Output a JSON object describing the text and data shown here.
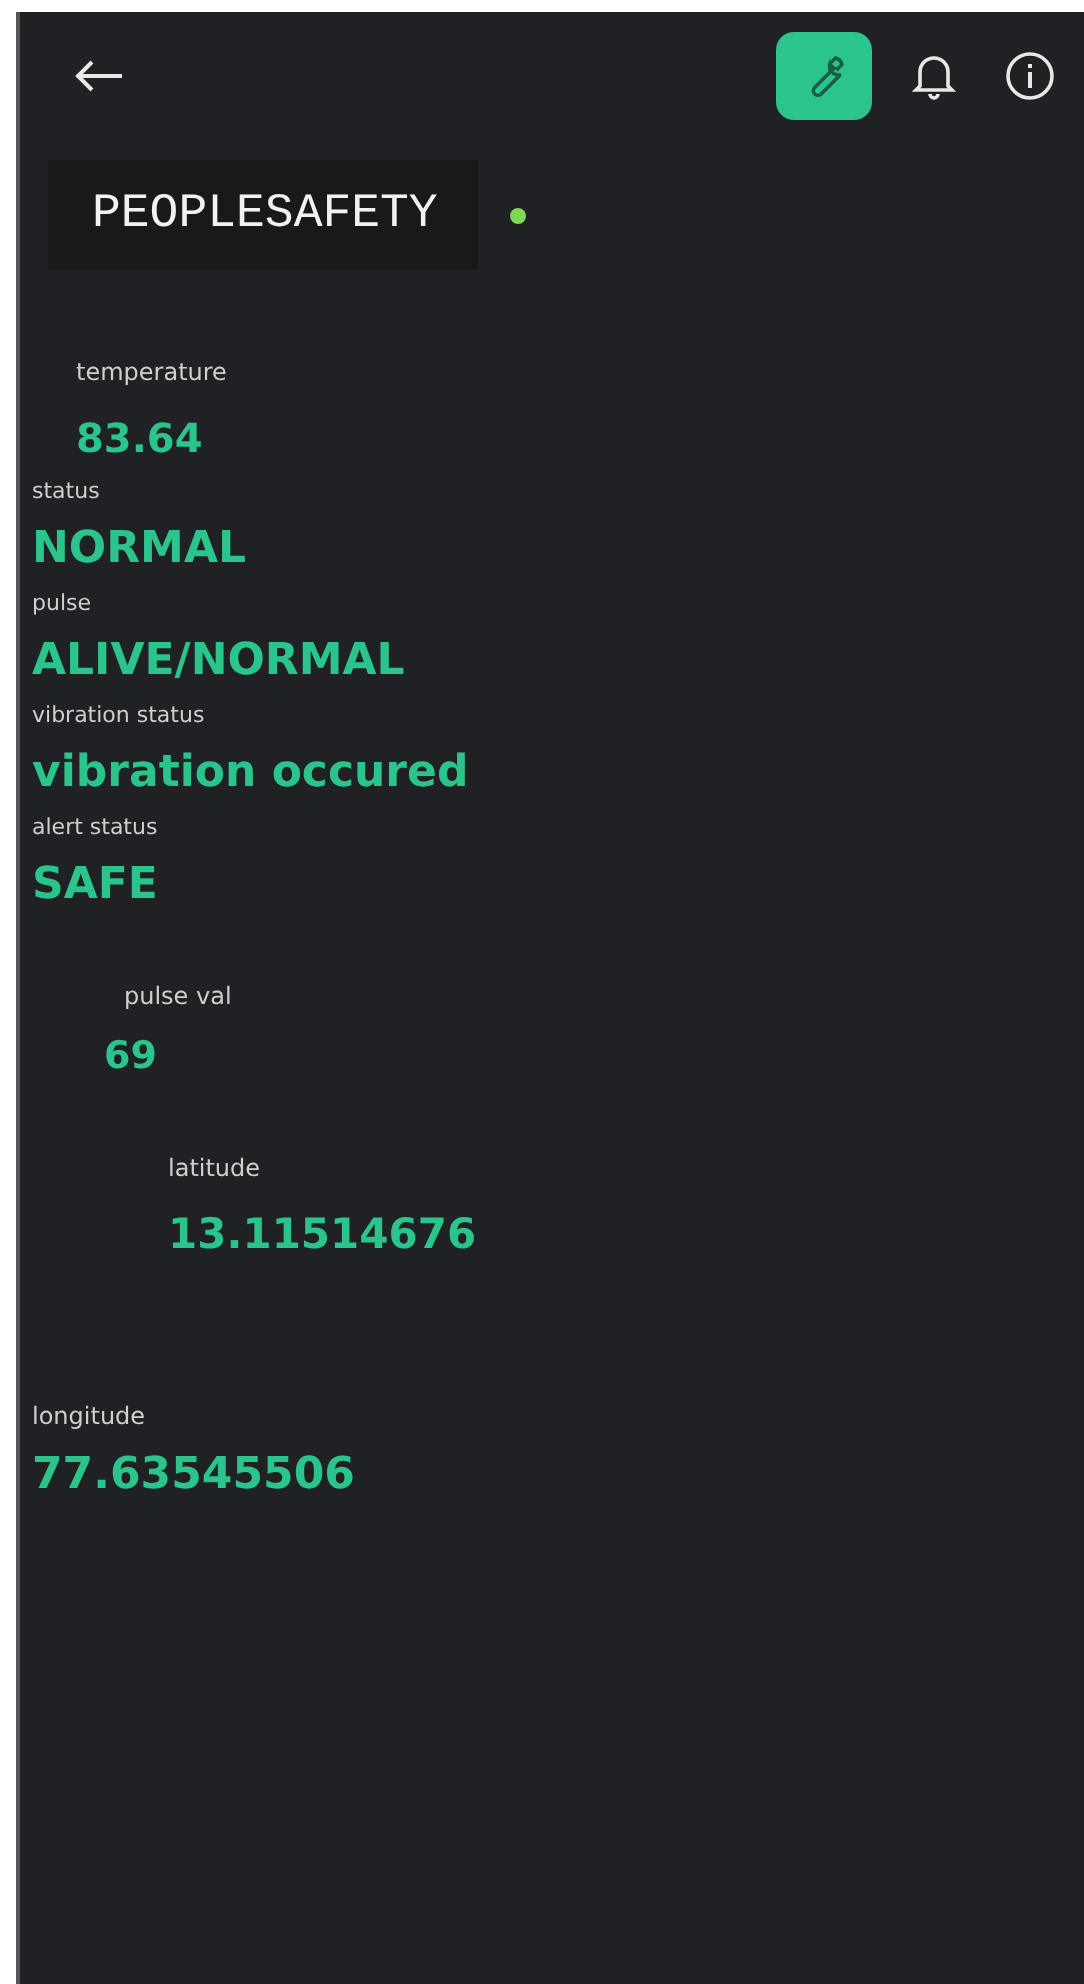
{
  "header": {
    "title": "PEOPLESAFETY",
    "online": true
  },
  "widgets": [
    {
      "label": "temperature",
      "value": "83.64"
    },
    {
      "label": "status",
      "value": "NORMAL"
    },
    {
      "label": "pulse",
      "value": "ALIVE/NORMAL"
    },
    {
      "label": "vibration status",
      "value": "vibration occured"
    },
    {
      "label": "alert status",
      "value": "SAFE"
    },
    {
      "label": "pulse val",
      "value": "69"
    },
    {
      "label": "latitude",
      "value": "13.11514676"
    },
    {
      "label": "longitude",
      "value": "77.63545506"
    }
  ]
}
